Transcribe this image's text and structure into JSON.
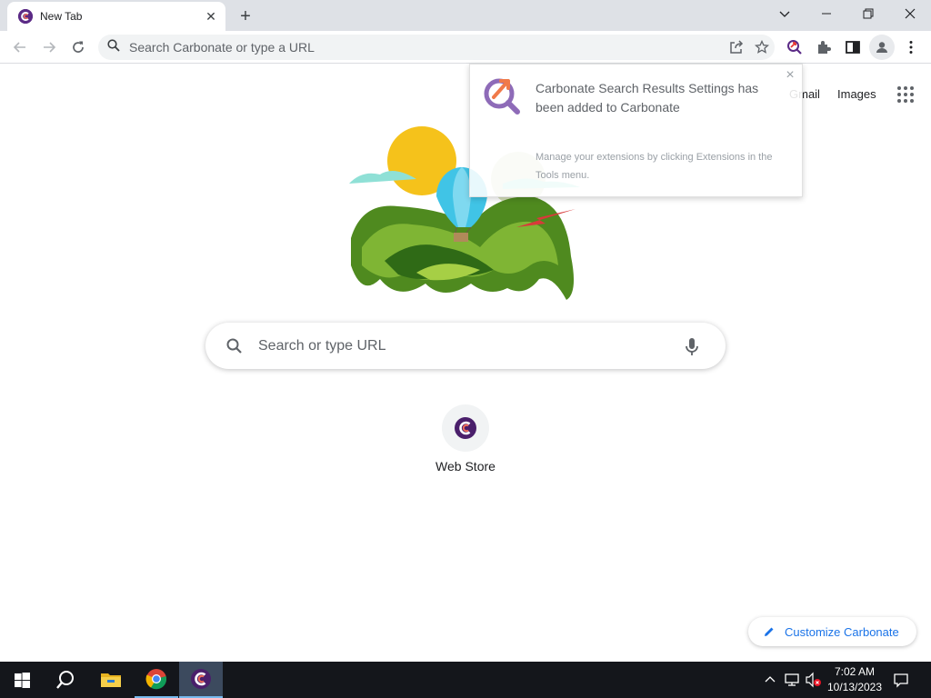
{
  "browser": {
    "tab": {
      "title": "New Tab"
    },
    "omnibox": {
      "placeholder": "Search Carbonate or type a URL"
    }
  },
  "header": {
    "gmail": "Gmail",
    "images": "Images"
  },
  "search": {
    "placeholder": "Search or type URL"
  },
  "shortcuts": [
    {
      "label": "Web Store"
    }
  ],
  "popup": {
    "title": "Carbonate Search Results Settings has been added to Carbonate",
    "note": "Manage your extensions by clicking Extensions in the Tools menu."
  },
  "customize": {
    "label": "Customize Carbonate"
  },
  "taskbar": {
    "time": "7:02 AM",
    "date": "10/13/2023",
    "apps": [
      "start-icon",
      "search-icon",
      "file-explorer-icon",
      "chrome-icon",
      "carbonate-icon"
    ]
  },
  "colors": {
    "accent": "#1a73e8",
    "brand": "#5b2a86",
    "taskbar": "#14161b"
  }
}
